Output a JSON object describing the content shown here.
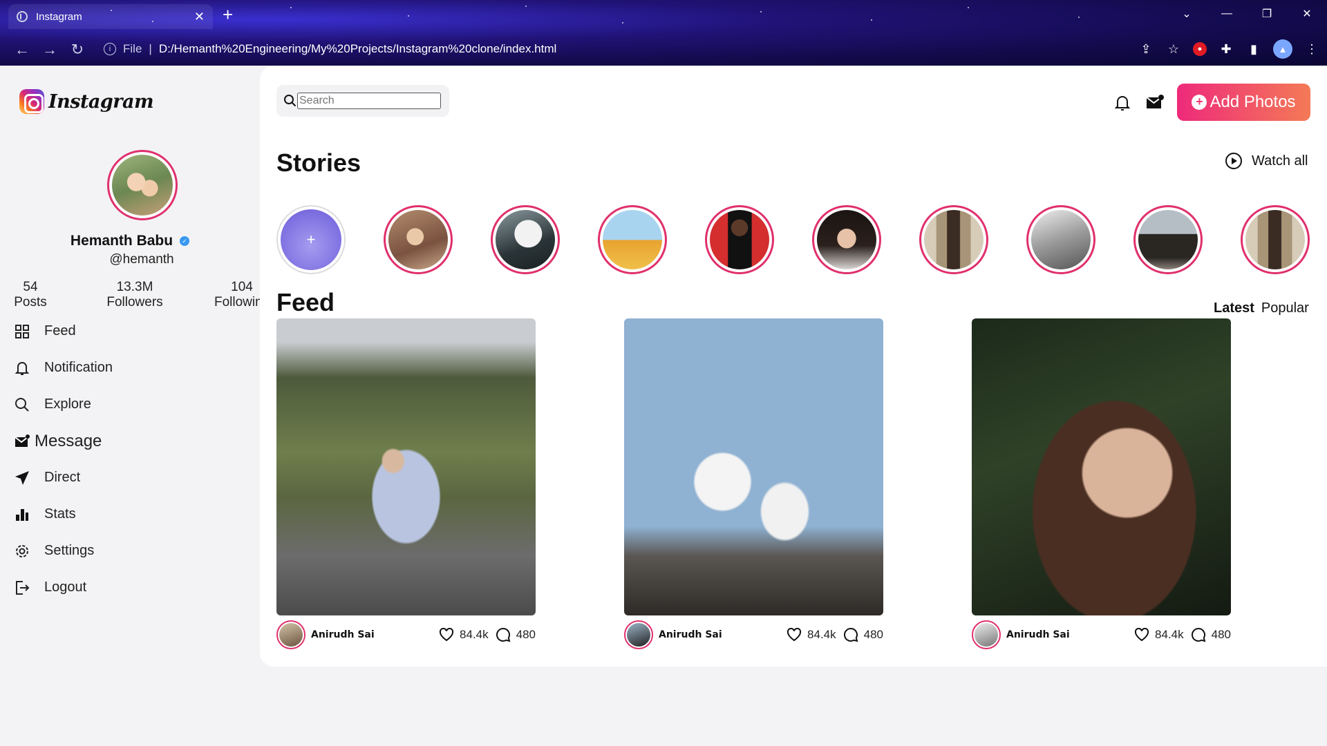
{
  "browser": {
    "tab_title": "Instagram",
    "url_scheme": "File",
    "url": "D:/Hemanth%20Engineering/My%20Projects/Instagram%20clone/index.html"
  },
  "sidebar": {
    "logo_text": "Instagram",
    "profile": {
      "name": "Hemanth Babu",
      "handle": "@hemanth"
    },
    "stats": [
      {
        "value": "54",
        "label": "Posts"
      },
      {
        "value": "13.3M",
        "label": "Followers"
      },
      {
        "value": "104",
        "label": "Following"
      }
    ],
    "menu": [
      {
        "label": "Feed",
        "icon": "grid-icon"
      },
      {
        "label": "Notification",
        "icon": "bell-icon"
      },
      {
        "label": "Explore",
        "icon": "search-icon"
      },
      {
        "label": "Message",
        "icon": "mail-icon"
      },
      {
        "label": "Direct",
        "icon": "send-icon"
      },
      {
        "label": "Stats",
        "icon": "bar-chart-icon"
      },
      {
        "label": "Settings",
        "icon": "gear-icon"
      },
      {
        "label": "Logout",
        "icon": "logout-icon"
      }
    ]
  },
  "header": {
    "search_placeholder": "Search",
    "add_button": "Add Photos"
  },
  "stories": {
    "title": "Stories",
    "watch_all": "Watch all",
    "count": 10
  },
  "feed": {
    "title": "Feed",
    "tabs": [
      "Latest",
      "Popular"
    ],
    "posts": [
      {
        "author": "Anirudh Sai",
        "likes": "84.4k",
        "comments": "480"
      },
      {
        "author": "Anirudh Sai",
        "likes": "84.4k",
        "comments": "480"
      },
      {
        "author": "Anirudh Sai",
        "likes": "84.4k",
        "comments": "480"
      }
    ]
  },
  "colors": {
    "accent": "#e0306c",
    "button_gradient_start": "#ee2a7b",
    "button_gradient_end": "#f47a56",
    "verified": "#3897f0"
  }
}
